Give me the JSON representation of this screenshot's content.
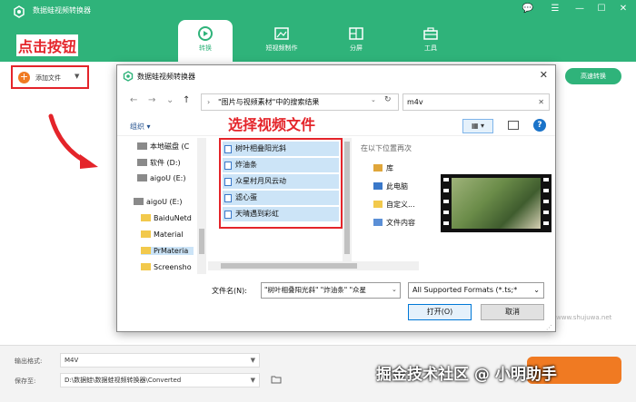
{
  "app": {
    "title": "数据蛙视频转换器",
    "window_controls": [
      "💬",
      "☰",
      "—",
      "☐",
      "✕"
    ],
    "colors": {
      "brand_green": "#2fb37a",
      "accent_orange": "#f07a22",
      "annotation_red": "#e4242a"
    }
  },
  "tabs": [
    {
      "label": "转换",
      "icon": "convert-icon",
      "active": true
    },
    {
      "label": "短视频制作",
      "icon": "short-video-icon",
      "active": false
    },
    {
      "label": "分屏",
      "icon": "split-screen-icon",
      "active": false
    },
    {
      "label": "工具",
      "icon": "toolbox-icon",
      "active": false
    }
  ],
  "toolbar": {
    "add_file_label": "添加文件",
    "add_file_caret": "▼",
    "convert_all_label": "高速转换"
  },
  "annotations": {
    "click_button": "点击按钮",
    "select_video_files": "选择视频文件"
  },
  "dialog": {
    "title": "数据蛙视频转换器",
    "close": "✕",
    "nav": {
      "back": "←",
      "forward": "→",
      "down": "⌄",
      "up": "↑"
    },
    "address_sep": "›",
    "address": "\"图片与视频素材\"中的搜索结果",
    "address_dd": "⌄",
    "refresh": "↻",
    "search_value": "m4v",
    "search_clear": "✕",
    "organize_label": "组织 ▾",
    "view_label": "▦ ▾",
    "help_label": "?",
    "tree": [
      {
        "label": "本地磁盘 (C",
        "icon": "drive-icon"
      },
      {
        "label": "软件 (D:)",
        "icon": "drive-icon"
      },
      {
        "label": "aigoU (E:)",
        "icon": "drive-icon"
      },
      {
        "label": "aigoU (E:)",
        "icon": "drive-icon"
      },
      {
        "label": "BaiduNetd",
        "icon": "folder-icon"
      },
      {
        "label": "Material",
        "icon": "folder-icon"
      },
      {
        "label": "PrMateria",
        "icon": "folder-icon"
      },
      {
        "label": "Screensho",
        "icon": "folder-icon"
      }
    ],
    "files": [
      "树叶相叠阳光斜",
      "炸油条",
      "众星村月风云动",
      "滤心蛋",
      "天晴遇到彩虹"
    ],
    "preview": {
      "header": "在以下位置再次",
      "locations": [
        {
          "label": "库",
          "icon": "library-icon"
        },
        {
          "label": "此电脑",
          "icon": "computer-icon"
        },
        {
          "label": "自定义...",
          "icon": "folder-icon"
        },
        {
          "label": "文件内容",
          "icon": "document-icon"
        }
      ]
    },
    "filename_label": "文件名(N):",
    "filename_value": "\"树叶相叠阳光斜\" \"炸油条\" \"众星",
    "filename_dd": "⌄",
    "filter_value": "All Supported Formats (*.ts;*",
    "filter_dd": "⌄",
    "open_label": "打开(O)",
    "cancel_label": "取消"
  },
  "bottom": {
    "output_format_label": "输出格式:",
    "output_format_value": "M4V",
    "save_to_label": "保存至:",
    "save_to_value": "D:\\数据蛙\\数据蛙视频转换器\\Converted",
    "dd": "▼"
  },
  "watermarks": {
    "small": "www.shujuwa.net",
    "large": "掘金技术社区 @ 小明助手"
  }
}
